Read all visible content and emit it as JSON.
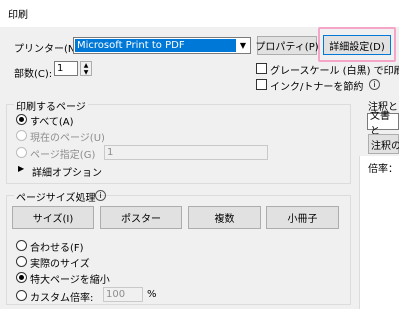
{
  "window": {
    "title": "印刷"
  },
  "printer": {
    "label": "プリンター(N):",
    "selected": "Microsoft Print to PDF",
    "properties_button": "プロパティ(P)",
    "advanced_button": "詳細設定(D)"
  },
  "copies": {
    "label": "部数(C):",
    "value": "1"
  },
  "options": {
    "grayscale": "グレースケール (白黒) で印刷(Y)",
    "save_ink": "インク/トナーを節約"
  },
  "print_range": {
    "title": "印刷するページ",
    "all": "すべて(A)",
    "current": "現在のページ(U)",
    "pages": "ページ指定(G)",
    "pages_value": "1",
    "more": "詳細オプション"
  },
  "page_sizing": {
    "title": "ページサイズ処理",
    "buttons": [
      "サイズ(I)",
      "ポスター",
      "複数",
      "小冊子"
    ],
    "fit": "合わせる(F)",
    "actual": "実際のサイズ",
    "shrink": "特大ページを縮小",
    "custom": "カスタム倍率:",
    "custom_value": "100",
    "percent": "%"
  },
  "right": {
    "annotations_label": "注釈とフ",
    "doc_select": "文書と",
    "summary_button": "注釈の",
    "zoom_label": "倍率："
  }
}
